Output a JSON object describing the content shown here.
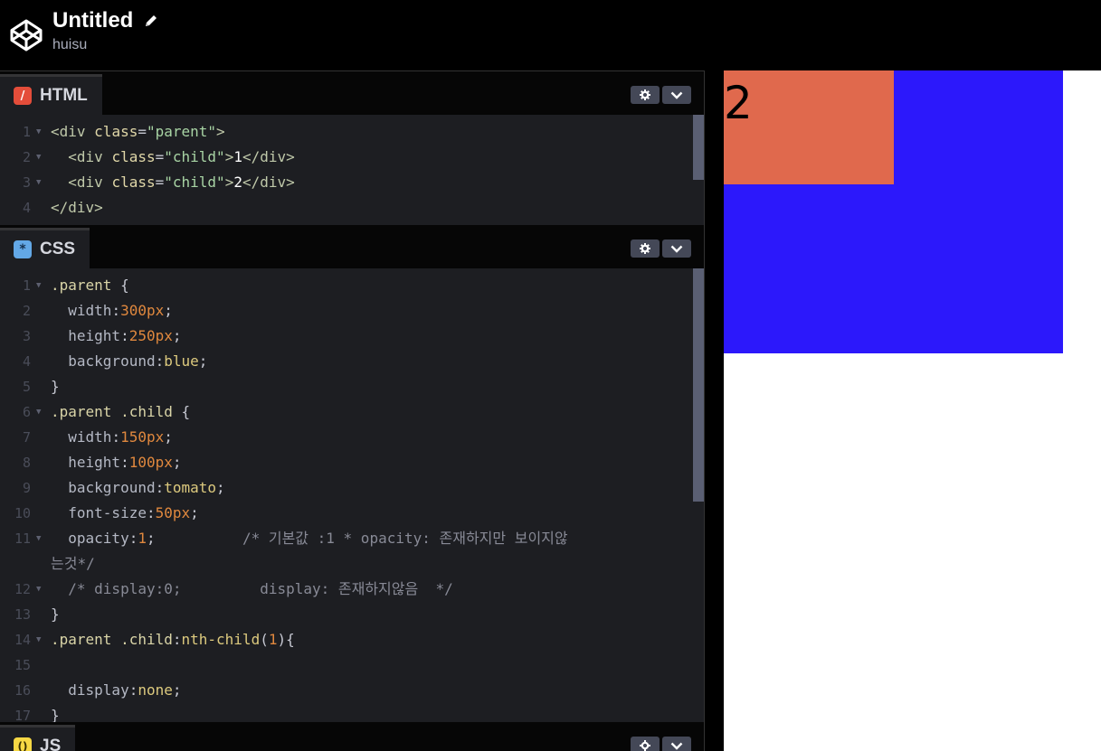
{
  "header": {
    "title": "Untitled",
    "user": "huisu"
  },
  "html_panel": {
    "label": "HTML",
    "icon": "html-icon",
    "lines": [
      {
        "n": "1",
        "fold": true,
        "parts": [
          [
            "tagc",
            "<div "
          ],
          [
            "attr",
            "class"
          ],
          [
            "punc",
            "="
          ],
          [
            "str",
            "\"parent\""
          ],
          [
            "tagc",
            ">"
          ]
        ]
      },
      {
        "n": "2",
        "fold": true,
        "parts": [
          [
            "tagc",
            "  <div "
          ],
          [
            "attr",
            "class"
          ],
          [
            "punc",
            "="
          ],
          [
            "str",
            "\"child\""
          ],
          [
            "tagc",
            ">"
          ],
          [
            "plain",
            "1"
          ],
          [
            "tagc",
            "</div>"
          ]
        ]
      },
      {
        "n": "3",
        "fold": true,
        "parts": [
          [
            "tagc",
            "  <div "
          ],
          [
            "attr",
            "class"
          ],
          [
            "punc",
            "="
          ],
          [
            "str",
            "\"child\""
          ],
          [
            "tagc",
            ">"
          ],
          [
            "plain",
            "2"
          ],
          [
            "tagc",
            "</div>"
          ]
        ]
      },
      {
        "n": "4",
        "fold": false,
        "parts": [
          [
            "tagc",
            "</div>"
          ]
        ]
      }
    ]
  },
  "css_panel": {
    "label": "CSS",
    "icon": "css-icon",
    "lines": [
      {
        "n": "1",
        "fold": true,
        "parts": [
          [
            "sel",
            ".parent "
          ],
          [
            "punc",
            "{"
          ]
        ]
      },
      {
        "n": "2",
        "fold": false,
        "parts": [
          [
            "prop",
            "  width"
          ],
          [
            "punc",
            ":"
          ],
          [
            "num",
            "300px"
          ],
          [
            "punc",
            ";"
          ]
        ]
      },
      {
        "n": "3",
        "fold": false,
        "parts": [
          [
            "prop",
            "  height"
          ],
          [
            "punc",
            ":"
          ],
          [
            "num",
            "250px"
          ],
          [
            "punc",
            ";"
          ]
        ]
      },
      {
        "n": "4",
        "fold": false,
        "parts": [
          [
            "prop",
            "  background"
          ],
          [
            "punc",
            ":"
          ],
          [
            "val",
            "blue"
          ],
          [
            "punc",
            ";"
          ]
        ]
      },
      {
        "n": "5",
        "fold": false,
        "parts": [
          [
            "punc",
            "}"
          ]
        ]
      },
      {
        "n": "6",
        "fold": true,
        "parts": [
          [
            "sel",
            ".parent .child "
          ],
          [
            "punc",
            "{"
          ]
        ]
      },
      {
        "n": "7",
        "fold": false,
        "parts": [
          [
            "prop",
            "  width"
          ],
          [
            "punc",
            ":"
          ],
          [
            "num",
            "150px"
          ],
          [
            "punc",
            ";"
          ]
        ]
      },
      {
        "n": "8",
        "fold": false,
        "parts": [
          [
            "prop",
            "  height"
          ],
          [
            "punc",
            ":"
          ],
          [
            "num",
            "100px"
          ],
          [
            "punc",
            ";"
          ]
        ]
      },
      {
        "n": "9",
        "fold": false,
        "parts": [
          [
            "prop",
            "  background"
          ],
          [
            "punc",
            ":"
          ],
          [
            "val",
            "tomato"
          ],
          [
            "punc",
            ";"
          ]
        ]
      },
      {
        "n": "10",
        "fold": false,
        "parts": [
          [
            "prop",
            "  font-size"
          ],
          [
            "punc",
            ":"
          ],
          [
            "num",
            "50px"
          ],
          [
            "punc",
            ";"
          ]
        ]
      },
      {
        "n": "11",
        "fold": true,
        "parts": [
          [
            "prop",
            "  opacity"
          ],
          [
            "punc",
            ":"
          ],
          [
            "num",
            "1"
          ],
          [
            "punc",
            ";"
          ],
          [
            "cmt",
            "          /* 기본값 :1 * opacity: 존재하지만 보이지않"
          ]
        ]
      },
      {
        "n": "",
        "fold": false,
        "parts": [
          [
            "cmt",
            "는것*/"
          ]
        ]
      },
      {
        "n": "12",
        "fold": true,
        "parts": [
          [
            "cmt",
            "  /* display:0;         display: 존재하지않음  */"
          ]
        ]
      },
      {
        "n": "13",
        "fold": false,
        "parts": [
          [
            "punc",
            "}"
          ]
        ]
      },
      {
        "n": "14",
        "fold": true,
        "parts": [
          [
            "sel",
            ".parent .child"
          ],
          [
            "punc",
            ":"
          ],
          [
            "val",
            "nth-child"
          ],
          [
            "punc",
            "("
          ],
          [
            "num",
            "1"
          ],
          [
            "punc",
            "){"
          ]
        ]
      },
      {
        "n": "15",
        "fold": false,
        "parts": []
      },
      {
        "n": "16",
        "fold": false,
        "parts": [
          [
            "prop",
            "  display"
          ],
          [
            "punc",
            ":"
          ],
          [
            "val",
            "none"
          ],
          [
            "punc",
            ";"
          ]
        ]
      },
      {
        "n": "17",
        "fold": false,
        "parts": [
          [
            "punc",
            "}"
          ]
        ]
      }
    ]
  },
  "js_panel": {
    "label": "JS",
    "icon": "js-icon"
  },
  "preview": {
    "child_text": "2",
    "parent_color": "#2c18fb",
    "child_color": "#e0694d"
  },
  "colors": {
    "html_icon": "#e44d3a",
    "css_icon": "#63a8e6",
    "js_icon": "#f7d844"
  }
}
